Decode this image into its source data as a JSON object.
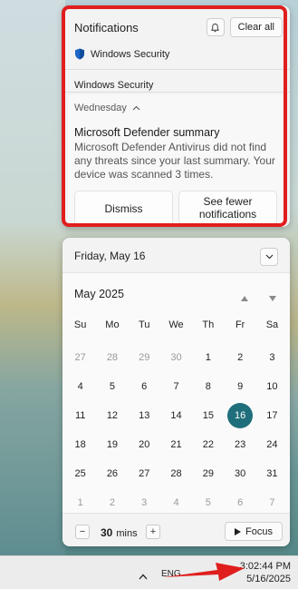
{
  "notifications": {
    "title": "Notifications",
    "clear_all": "Clear all",
    "app_label": "Windows Security",
    "app_group": "Windows Security",
    "toast": {
      "day": "Wednesday",
      "title": "Microsoft Defender summary",
      "body": "Microsoft Defender Antivirus did not find any threats since your last summary. Your device was scanned 3 times.",
      "dismiss": "Dismiss",
      "see_fewer": "See fewer notifications"
    }
  },
  "calendar": {
    "header_date": "Friday, May 16",
    "month": "May 2025",
    "weekdays": [
      "Su",
      "Mo",
      "Tu",
      "We",
      "Th",
      "Fr",
      "Sa"
    ],
    "weeks": [
      [
        "27",
        "28",
        "29",
        "30",
        "1",
        "2",
        "3"
      ],
      [
        "4",
        "5",
        "6",
        "7",
        "8",
        "9",
        "10"
      ],
      [
        "11",
        "12",
        "13",
        "14",
        "15",
        "16",
        "17"
      ],
      [
        "18",
        "19",
        "20",
        "21",
        "22",
        "23",
        "24"
      ],
      [
        "25",
        "26",
        "27",
        "28",
        "29",
        "30",
        "31"
      ],
      [
        "1",
        "2",
        "3",
        "4",
        "5",
        "6",
        "7"
      ]
    ],
    "muted_first_week_count": 4,
    "muted_last_week": true,
    "selected_day": "16",
    "today_color": "#1f6e7b"
  },
  "focus": {
    "minutes": "30",
    "unit": "mins",
    "decrease": "−",
    "increase": "+",
    "button": "Focus"
  },
  "taskbar": {
    "language": "ENG",
    "time": "3:02:44 PM",
    "date": "5/16/2025"
  },
  "colors": {
    "highlight": "#e01e1e",
    "accent": "#1f6e7b"
  }
}
